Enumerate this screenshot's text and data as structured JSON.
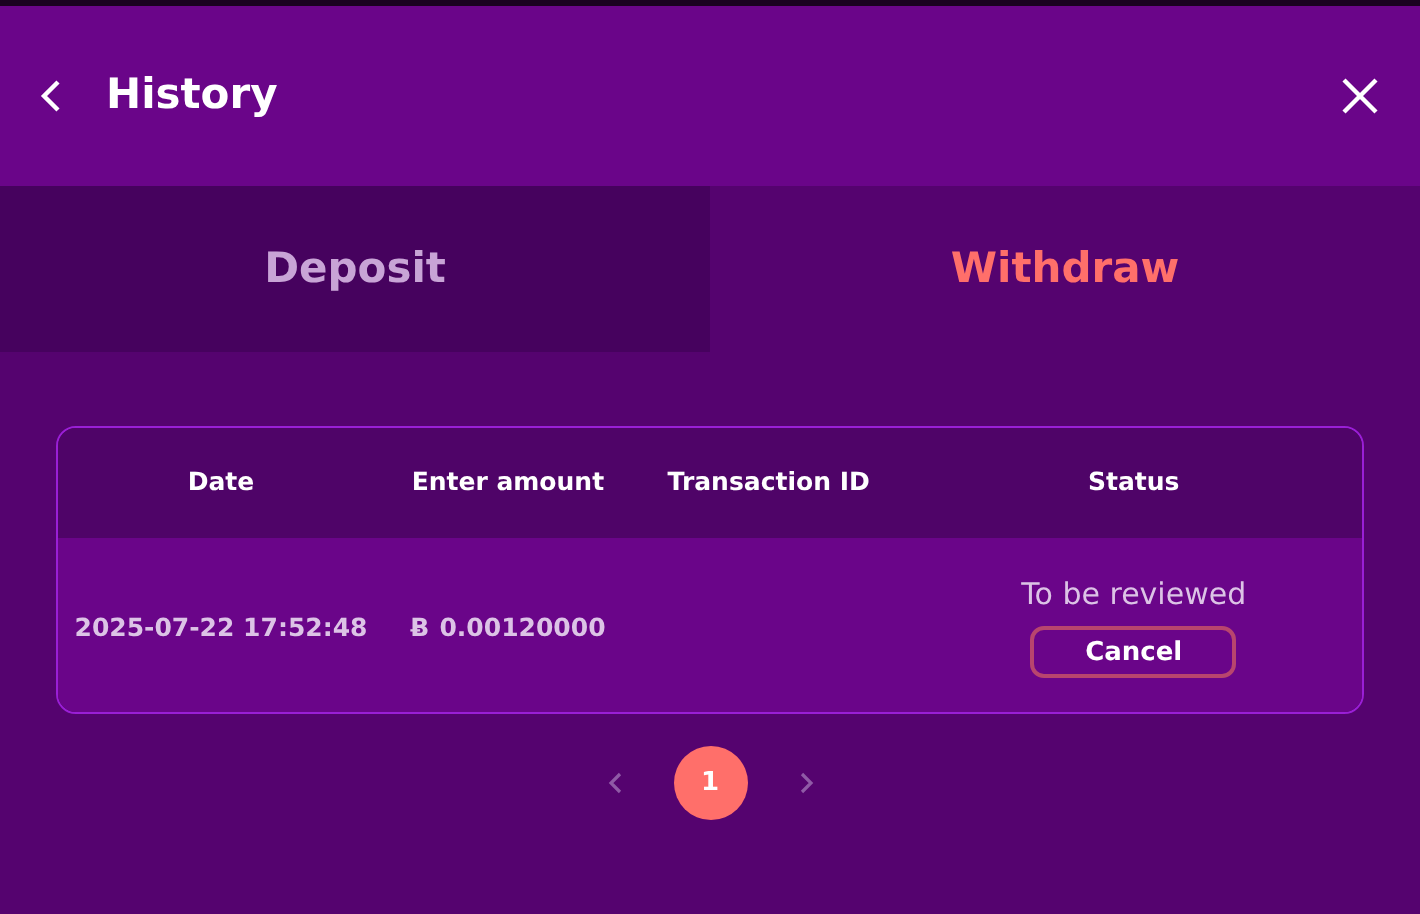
{
  "header": {
    "title": "History"
  },
  "tabs": [
    {
      "label": "Deposit",
      "selected": false
    },
    {
      "label": "Withdraw",
      "selected": true
    }
  ],
  "table": {
    "columns": [
      "Date",
      "Enter amount",
      "Transaction ID",
      "Status"
    ],
    "rows": [
      {
        "date": "2025-07-22 17:52:48",
        "currency": "Ƀ",
        "amount": "0.00120000",
        "status": "To be reviewed",
        "action": "Cancel"
      }
    ]
  },
  "pagination": {
    "pages": [
      {
        "label": "1",
        "selected": true
      }
    ]
  }
}
